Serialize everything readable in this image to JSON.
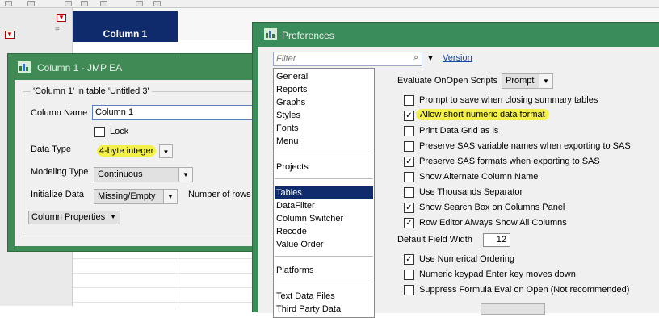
{
  "table": {
    "column_header": "Column 1"
  },
  "column_dialog": {
    "title": "Column 1 - JMP EA",
    "caption": "'Column 1' in table 'Untitled 3'",
    "column_name_label": "Column Name",
    "column_name_value": "Column 1",
    "lock_label": "Lock",
    "lock_checked": false,
    "data_type_label": "Data Type",
    "data_type_value": "4-byte integer",
    "modeling_type_label": "Modeling Type",
    "modeling_type_value": "Continuous",
    "initialize_label": "Initialize Data",
    "initialize_value": "Missing/Empty",
    "number_of_rows_label": "Number of rows",
    "column_properties_label": "Column Properties"
  },
  "preferences": {
    "title": "Preferences",
    "filter_placeholder": "Filter",
    "version_link": "Version",
    "categories": [
      {
        "label": "General",
        "selected": false
      },
      {
        "label": "Reports",
        "selected": false
      },
      {
        "label": "Graphs",
        "selected": false
      },
      {
        "label": "Styles",
        "selected": false
      },
      {
        "label": "Fonts",
        "selected": false
      },
      {
        "label": "Menu",
        "selected": false
      },
      {
        "label": "Projects",
        "selected": false
      },
      {
        "label": "Tables",
        "selected": true
      },
      {
        "label": "DataFilter",
        "selected": false
      },
      {
        "label": "Column Switcher",
        "selected": false
      },
      {
        "label": "Recode",
        "selected": false
      },
      {
        "label": "Value Order",
        "selected": false
      },
      {
        "label": "Platforms",
        "selected": false
      },
      {
        "label": "Text Data Files",
        "selected": false
      },
      {
        "label": "Third Party Data",
        "selected": false
      }
    ],
    "evaluate_label": "Evaluate OnOpen Scripts",
    "evaluate_value": "Prompt",
    "options": [
      {
        "label": "Prompt to save when closing summary tables",
        "checked": false
      },
      {
        "label": "Allow short numeric data format",
        "checked": true
      },
      {
        "label": "Print Data Grid as is",
        "checked": false
      },
      {
        "label": "Preserve SAS variable names when exporting to SAS",
        "checked": false
      },
      {
        "label": "Preserve SAS formats when exporting to SAS",
        "checked": true
      },
      {
        "label": "Show Alternate Column Name",
        "checked": false
      },
      {
        "label": "Use Thousands Separator",
        "checked": false
      },
      {
        "label": "Show Search Box on Columns Panel",
        "checked": true
      },
      {
        "label": "Row Editor Always Show All Columns",
        "checked": true
      }
    ],
    "default_field_width_label": "Default Field Width",
    "default_field_width_value": "12",
    "options2": [
      {
        "label": "Use Numerical Ordering",
        "checked": true
      },
      {
        "label": "Numeric keypad Enter key moves down",
        "checked": false
      },
      {
        "label": "Suppress Formula Eval on Open (Not recommended)",
        "checked": false
      }
    ]
  },
  "colors": {
    "dialog_frame": "#3f8a55",
    "header_navy": "#0f2b6b",
    "highlight": "#f4f04a",
    "link": "#1a4aa8"
  }
}
